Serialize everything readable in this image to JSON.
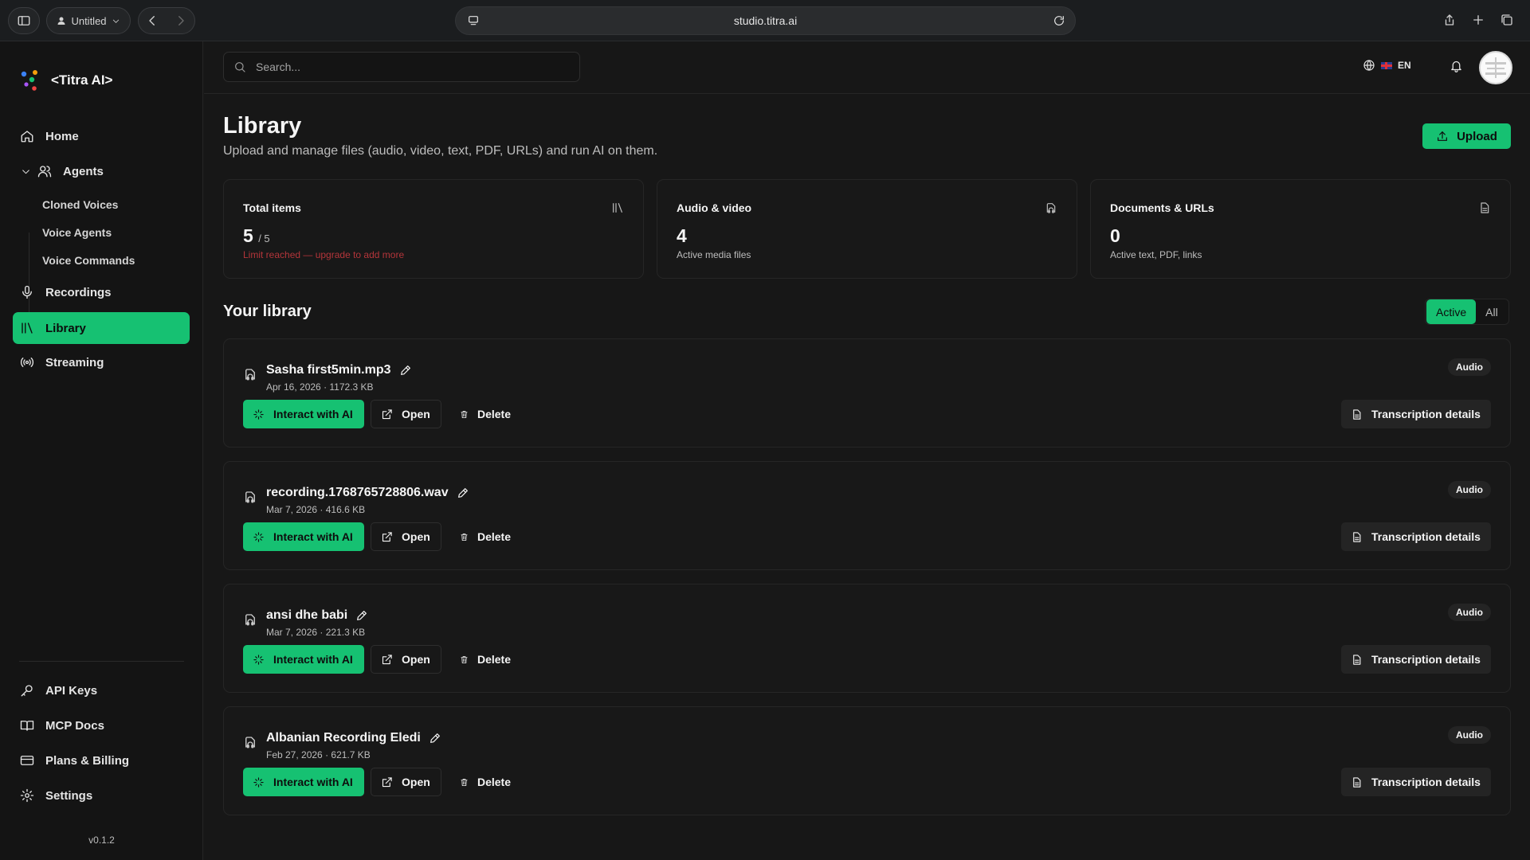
{
  "browser": {
    "profile_label": "Untitled",
    "url": "studio.titra.ai"
  },
  "brand": {
    "name": "<Titra AI>"
  },
  "sidebar": {
    "items": [
      {
        "label": "Home"
      },
      {
        "label": "Agents"
      },
      {
        "label": "Recordings"
      },
      {
        "label": "Library"
      },
      {
        "label": "Streaming"
      }
    ],
    "agents_sub": [
      {
        "label": "Cloned Voices"
      },
      {
        "label": "Voice Agents"
      },
      {
        "label": "Voice Commands"
      }
    ],
    "bottom_items": [
      {
        "label": "API Keys"
      },
      {
        "label": "MCP Docs"
      },
      {
        "label": "Plans & Billing"
      },
      {
        "label": "Settings"
      }
    ],
    "version": "v0.1.2"
  },
  "header": {
    "search_placeholder": "Search...",
    "language": "EN"
  },
  "page": {
    "title": "Library",
    "subtitle": "Upload and manage files (audio, video, text, PDF, URLs) and run AI on them.",
    "upload_label": "Upload"
  },
  "stats": [
    {
      "label": "Total items",
      "value": "5",
      "value_suffix": "/ 5",
      "note": "Limit reached — upgrade to add more"
    },
    {
      "label": "Audio & video",
      "value": "4",
      "note": "Active media files"
    },
    {
      "label": "Documents & URLs",
      "value": "0",
      "note": "Active text, PDF, links"
    }
  ],
  "library": {
    "title": "Your library",
    "filters": [
      "Active",
      "All"
    ],
    "active_filter": "Active",
    "actions": {
      "interact": "Interact with AI",
      "open": "Open",
      "delete": "Delete",
      "transcription": "Transcription details"
    },
    "items": [
      {
        "name": "Sasha first5min.mp3",
        "date": "Apr 16, 2026",
        "size": "· 1172.3 KB",
        "type": "Audio"
      },
      {
        "name": "recording.1768765728806.wav",
        "date": "Mar 7, 2026",
        "size": "· 416.6 KB",
        "type": "Audio"
      },
      {
        "name": "ansi dhe babi",
        "date": "Mar 7, 2026",
        "size": "· 221.3 KB",
        "type": "Audio"
      },
      {
        "name": "Albanian Recording Eledi",
        "date": "Feb 27, 2026",
        "size": "· 621.7 KB",
        "type": "Audio"
      }
    ]
  },
  "colors": {
    "accent": "#16c172",
    "background": "#171717",
    "sidebar": "#141414",
    "warning": "#b4353a"
  }
}
